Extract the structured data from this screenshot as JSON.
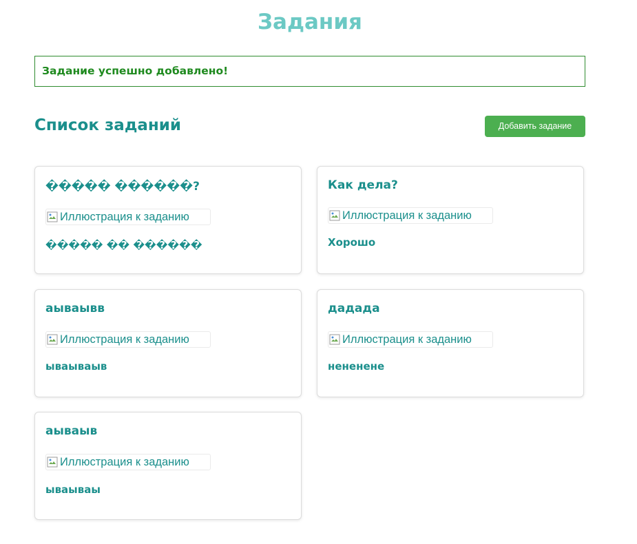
{
  "page": {
    "title": "Задания"
  },
  "alert": {
    "message": "Задание успешно добавлено!"
  },
  "tasks_section": {
    "heading": "Список заданий",
    "add_button_label": "Добавить задание"
  },
  "image_alt": "Иллюстрация к заданию",
  "colors": {
    "title": "#6cc9c4",
    "accent_text": "#1b8f8c",
    "alert_border": "#2e8b2e",
    "alert_text": "#1f8a1f",
    "button": "#4caf50"
  },
  "tasks": [
    {
      "title": "����� ������?",
      "text": "����� �� ������"
    },
    {
      "title": "Как дела?",
      "text": "Хорошо"
    },
    {
      "title": "аываывв",
      "text": "ываываыв"
    },
    {
      "title": "дадада",
      "text": "нененене"
    },
    {
      "title": "аываыв",
      "text": "ываываы"
    }
  ]
}
